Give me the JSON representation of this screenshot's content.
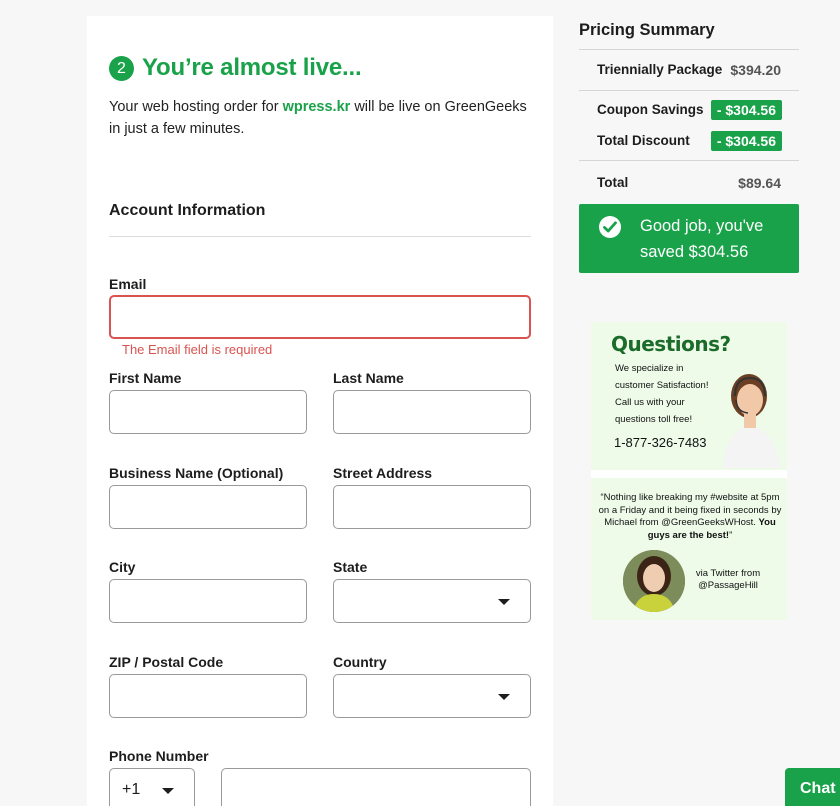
{
  "checkout": {
    "step_number": "2",
    "heading": "You’re almost live...",
    "intro_before": "Your web hosting order for ",
    "intro_domain": "wpress.kr",
    "intro_after": " will be live on GreenGeeks in just a few minutes.",
    "section_title": "Account Information",
    "fields": {
      "email_label": "Email",
      "email_error": "The Email field is required",
      "first_name_label": "First Name",
      "last_name_label": "Last Name",
      "business_label": "Business Name (Optional)",
      "street_label": "Street Address",
      "city_label": "City",
      "state_label": "State",
      "zip_label": "ZIP / Postal Code",
      "country_label": "Country",
      "phone_label": "Phone Number",
      "phone_code": "+1"
    }
  },
  "pricing": {
    "title": "Pricing Summary",
    "package_label": "Triennially Package",
    "package_value": "$394.20",
    "coupon_label": "Coupon Savings",
    "coupon_value": "- $304.56",
    "discount_label": "Total Discount",
    "discount_value": "- $304.56",
    "total_label": "Total",
    "total_value": "$89.64",
    "saved_message": "Good job, you've saved $304.56"
  },
  "promo": {
    "title": "Questions?",
    "text": "We specialize in customer Satisfaction! Call us with your questions toll free!",
    "phone": "1-877-326-7483",
    "quote": "“Nothing like breaking my #website at 5pm on a Friday and it being fixed in seconds by Michael from @GreenGeeksWHost.",
    "quote_bold": "You guys are the best!",
    "quote_end": "”",
    "via": "via Twitter from @PassageHill"
  },
  "chat": {
    "label": "Chat"
  },
  "colors": {
    "brand_green": "#19a24a",
    "error_red": "#d9534f"
  }
}
